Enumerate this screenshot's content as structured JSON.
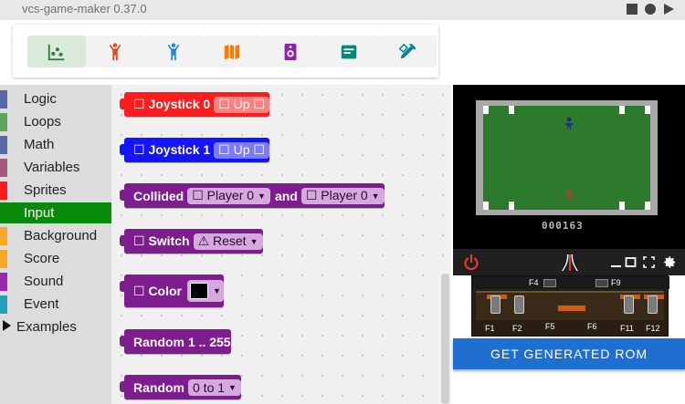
{
  "app": {
    "title": "vcs-game-maker 0.37.0"
  },
  "window_controls": [
    {
      "name": "stop-square-icon"
    },
    {
      "name": "record-circle-icon"
    },
    {
      "name": "play-triangle-icon"
    }
  ],
  "toolbar": {
    "tools": [
      {
        "icon": "scatter-chart-icon",
        "color": "#2e7d32",
        "active": true
      },
      {
        "icon": "person-arms-up-icon",
        "color": "#e64a19"
      },
      {
        "icon": "person-arms-up-icon",
        "color": "#1e88e5"
      },
      {
        "icon": "map-icon",
        "color": "#f57c00"
      },
      {
        "icon": "speaker-icon",
        "color": "#8e24aa"
      },
      {
        "icon": "message-icon",
        "color": "#00897b"
      },
      {
        "icon": "design-tools-icon",
        "color": "#00838f"
      }
    ]
  },
  "categories": [
    {
      "label": "Logic",
      "color": "#5b67a5"
    },
    {
      "label": "Loops",
      "color": "#5ba55b"
    },
    {
      "label": "Math",
      "color": "#5b67a5"
    },
    {
      "label": "Variables",
      "color": "#a55b80"
    },
    {
      "label": "Sprites",
      "color": "#ff1c1c"
    },
    {
      "label": "Input",
      "color": "#0a8a0a",
      "selected": true
    },
    {
      "label": "Background",
      "color": "#f9a825"
    },
    {
      "label": "Score",
      "color": "#f9a825"
    },
    {
      "label": "Sound",
      "color": "#9c27b0"
    },
    {
      "label": "Event",
      "color": "#26a0b8"
    }
  ],
  "examples": {
    "label": "Examples"
  },
  "blocks": {
    "joystick0": {
      "label": "☐ Joystick 0",
      "dropdown": "☐ Up ☐"
    },
    "joystick1": {
      "label": "☐ Joystick 1",
      "dropdown": "☐ Up ☐"
    },
    "collided": {
      "label": "Collided",
      "first": "☐ Player 0",
      "conj": "and",
      "second": "☐ Player 0"
    },
    "switch": {
      "label": "☐ Switch",
      "dropdown": "⚠ Reset"
    },
    "color": {
      "label": "☐ Color",
      "swatch": "#000000"
    },
    "random_range": {
      "label": "Random 1 .. 255"
    },
    "random_frac": {
      "label": "Random",
      "dropdown": "0 to 1"
    }
  },
  "emulator": {
    "score": "000163",
    "console": {
      "top_keys": [
        "F4",
        "F9"
      ],
      "bottom_keys": [
        "F1",
        "F2",
        "F5",
        "F6",
        "F11",
        "F12"
      ]
    }
  },
  "rom_button": {
    "label": "GET GENERATED ROM"
  }
}
